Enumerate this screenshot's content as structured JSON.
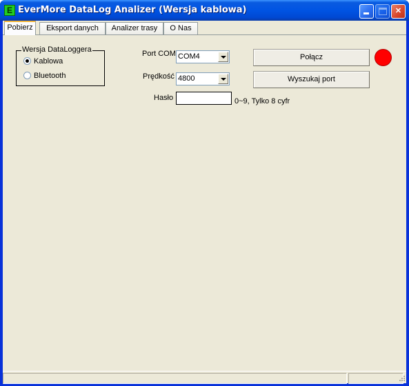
{
  "window": {
    "title": "EverMore DataLog Analizer (Wersja kablowa)",
    "icon_letter": "E"
  },
  "tabs": [
    {
      "label": "Pobierz",
      "active": true
    },
    {
      "label": "Eksport danych",
      "active": false
    },
    {
      "label": "Analizer trasy",
      "active": false
    },
    {
      "label": "O Nas",
      "active": false
    }
  ],
  "version_group": {
    "title": "Wersja DataLoggera",
    "options": [
      {
        "label": "Kablowa",
        "checked": true
      },
      {
        "label": "Bluetooth",
        "checked": false
      }
    ]
  },
  "connection": {
    "port_label": "Port COM",
    "port_value": "COM4",
    "speed_label": "Prędkość",
    "speed_value": "4800",
    "password_label": "Hasło",
    "password_value": "",
    "password_hint": "0~9, Tylko 8 cyfr",
    "connect_button": "Połącz",
    "find_port_button": "Wyszukaj port",
    "status_color": "#ff0000"
  }
}
